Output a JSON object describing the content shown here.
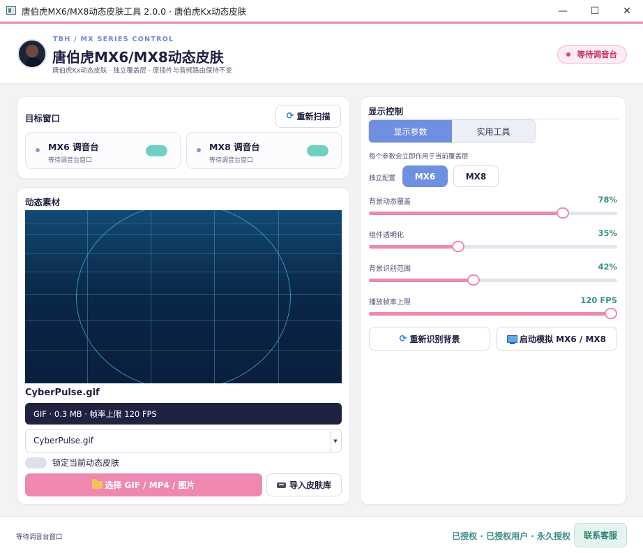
{
  "window": {
    "title": "唐伯虎MX6/MX8动态皮肤工具 2.0.0 · 唐伯虎Kx动态皮肤",
    "minimize_glyph": "—",
    "maximize_glyph": "☐",
    "close_glyph": "✕"
  },
  "header": {
    "kicker": "TBH  /  MX SERIES CONTROL",
    "title": "唐伯虎MX6/MX8动态皮肤",
    "subtitle": "唐伯虎Kx动态皮肤 · 独立覆盖层 · 原插件与音频路由保持不变",
    "status": "等待调音台"
  },
  "target": {
    "title": "目标窗口",
    "rescan_label": "重新扫描",
    "windows": [
      {
        "name": "MX6 调音台",
        "status": "等待调音台窗口"
      },
      {
        "name": "MX8 调音台",
        "status": "等待调音台窗口"
      }
    ]
  },
  "media": {
    "title": "动态素材",
    "file_name": "CyberPulse.gif",
    "meta": "GIF · 0.3 MB · 帧率上限 120 FPS",
    "selected_file": "CyberPulse.gif",
    "lock_label": "锁定当前动态皮肤",
    "choose_label": "选择 GIF / MP4 / 图片",
    "import_label": "导入皮肤库"
  },
  "display": {
    "title": "显示控制",
    "tabs": [
      {
        "label": "显示参数",
        "active": true
      },
      {
        "label": "实用工具",
        "active": false
      }
    ],
    "note": "每个参数会立即作用于当前覆盖层",
    "config_label": "独立配置",
    "config_options": [
      "MX6",
      "MX8"
    ],
    "sliders": [
      {
        "label": "背景动态覆盖",
        "value": "78%",
        "fraction": 0.78
      },
      {
        "label": "组件透明化",
        "value": "35%",
        "fraction": 0.36
      },
      {
        "label": "背景识别范围",
        "value": "42%",
        "fraction": 0.42
      },
      {
        "label": "播放帧率上限",
        "value": "120 FPS",
        "fraction": 1.0
      }
    ],
    "redetect_label": "重新识别背景",
    "launch_label": "启动模拟 MX6 / MX8"
  },
  "footer": {
    "status": "等待调音台窗口",
    "license": "已授权 · 已授权用户 · 永久授权",
    "support_label": "联系客服"
  },
  "colors": {
    "accent_pink": "#ee8db2",
    "accent_blue": "#6f8fe0",
    "accent_teal": "#3c8f8a",
    "dark": "#1f2240"
  }
}
